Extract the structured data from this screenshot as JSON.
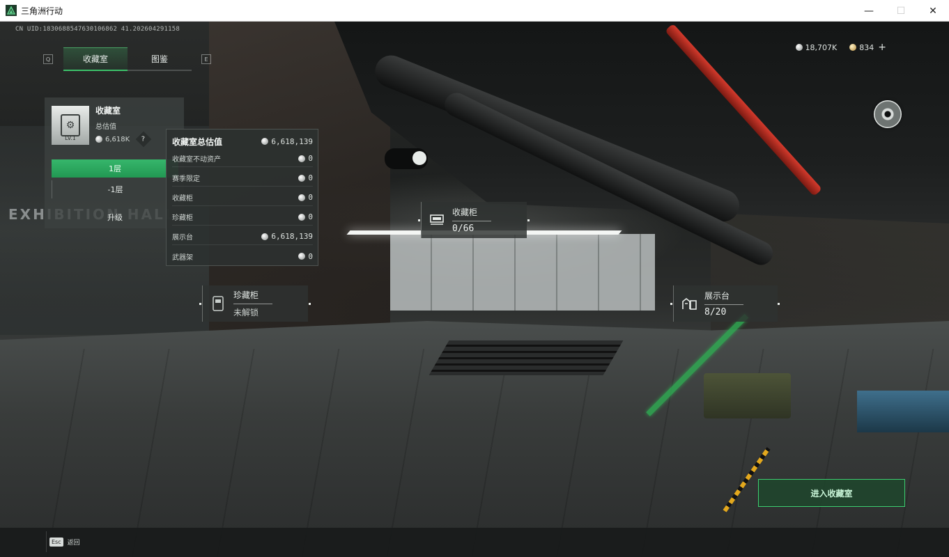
{
  "window": {
    "title": "三角洲行动",
    "minimize": "—",
    "maximize": "☐",
    "close": "✕"
  },
  "hud": {
    "uid": "CN UID:1830688547630106862 41.202604291158",
    "key_left": "Q",
    "key_right": "E",
    "tabs": [
      {
        "label": "收藏室",
        "active": true
      },
      {
        "label": "图鉴",
        "active": false
      }
    ],
    "currency": {
      "silver": "18,707K",
      "gold": "834",
      "add": "+"
    }
  },
  "collection": {
    "title": "收藏室",
    "level": "LV.1",
    "total_label": "总估值",
    "total_value": "6,618K",
    "help": "?",
    "floor_active": "1层",
    "floor_other": "-1层",
    "upgrade": "升级"
  },
  "valuation": {
    "title": "收藏室总估值",
    "total": "6,618,139",
    "rows": [
      {
        "label": "收藏室不动资产",
        "value": "0"
      },
      {
        "label": "赛季限定",
        "value": "0"
      },
      {
        "label": "收藏柜",
        "value": "0"
      },
      {
        "label": "珍藏柜",
        "value": "0"
      },
      {
        "label": "展示台",
        "value": "6,618,139"
      },
      {
        "label": "武器架",
        "value": "0"
      }
    ]
  },
  "markers": {
    "cabinet": {
      "name": "收藏柜",
      "count": "0/66"
    },
    "treasure": {
      "name": "珍藏柜",
      "state": "未解锁"
    },
    "display": {
      "name": "展示台",
      "count": "8/20"
    }
  },
  "scene": {
    "wall_text": "EXHIBITION HALL"
  },
  "actions": {
    "enter": "进入收藏室",
    "esc_key": "Esc",
    "back": "返回"
  }
}
